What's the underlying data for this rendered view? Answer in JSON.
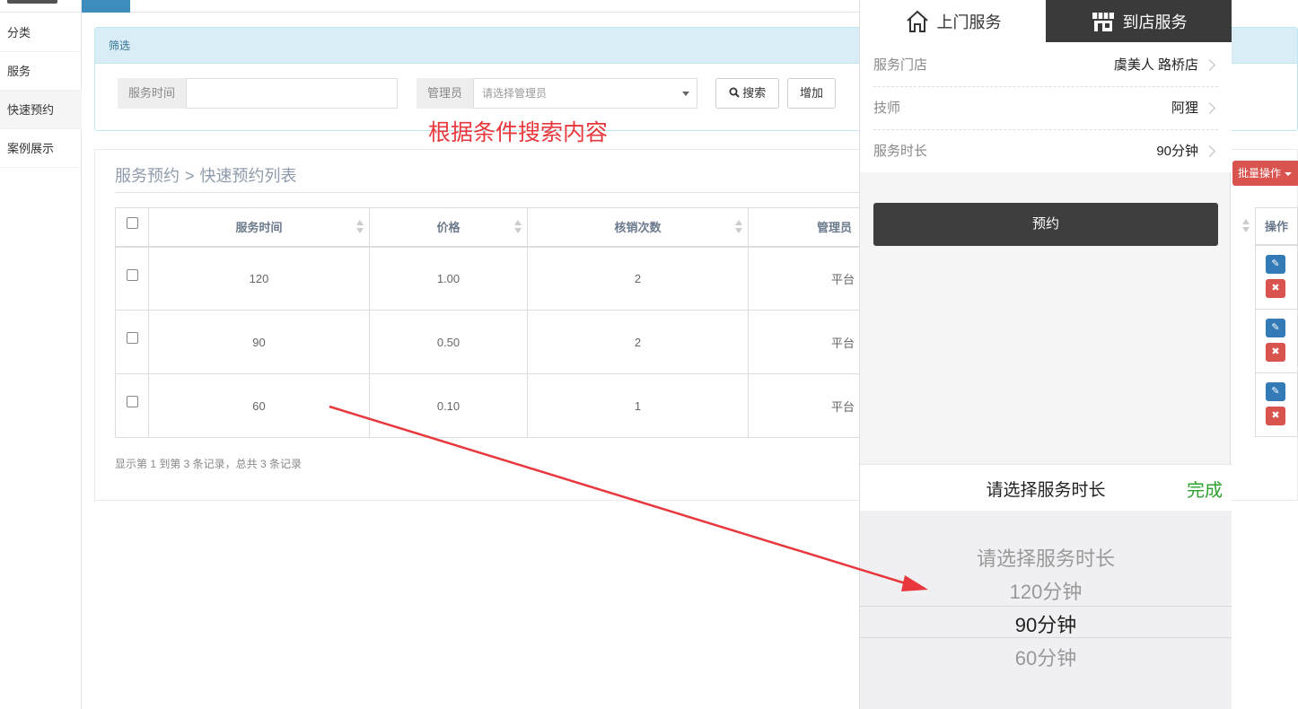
{
  "sidebar": {
    "items": [
      {
        "label": "分类"
      },
      {
        "label": "服务"
      },
      {
        "label": "快速预约"
      },
      {
        "label": "案例展示"
      }
    ]
  },
  "filter": {
    "header": "筛选",
    "service_time_label": "服务时间",
    "service_time_value": "",
    "admin_label": "管理员",
    "admin_placeholder": "请选择管理员",
    "search_label": "搜索",
    "add_label": "增加"
  },
  "annotation": "根据条件搜索内容",
  "list": {
    "breadcrumb_parent": "服务预约",
    "breadcrumb_sep": ">",
    "breadcrumb_current": "快速预约列表",
    "batch_label": "批量操作",
    "columns": [
      "服务时间",
      "价格",
      "核销次数",
      "管理员",
      "操作"
    ],
    "rows": [
      {
        "time": "120",
        "price": "1.00",
        "count": "2",
        "admin": "平台"
      },
      {
        "time": "90",
        "price": "0.50",
        "count": "2",
        "admin": "平台"
      },
      {
        "time": "60",
        "price": "0.10",
        "count": "1",
        "admin": "平台"
      }
    ],
    "page_info": "显示第 1 到第 3 条记录，总共 3 条记录"
  },
  "mobile": {
    "tab_home": "上门服务",
    "tab_store": "到店服务",
    "store_label": "服务门店",
    "store_value": "虞美人 路桥店",
    "tech_label": "技师",
    "tech_value": "阿狸",
    "duration_label": "服务时长",
    "duration_value": "90分钟",
    "book_label": "预约",
    "picker_title": "请选择服务时长",
    "picker_done": "完成",
    "options": [
      "请选择服务时长",
      "120分钟",
      "90分钟",
      "60分钟"
    ]
  },
  "colors": {
    "accent_blue": "#3c8dbc",
    "danger": "#d9534f",
    "done_green": "#2ea12e",
    "annotation_red": "#e8383d"
  }
}
